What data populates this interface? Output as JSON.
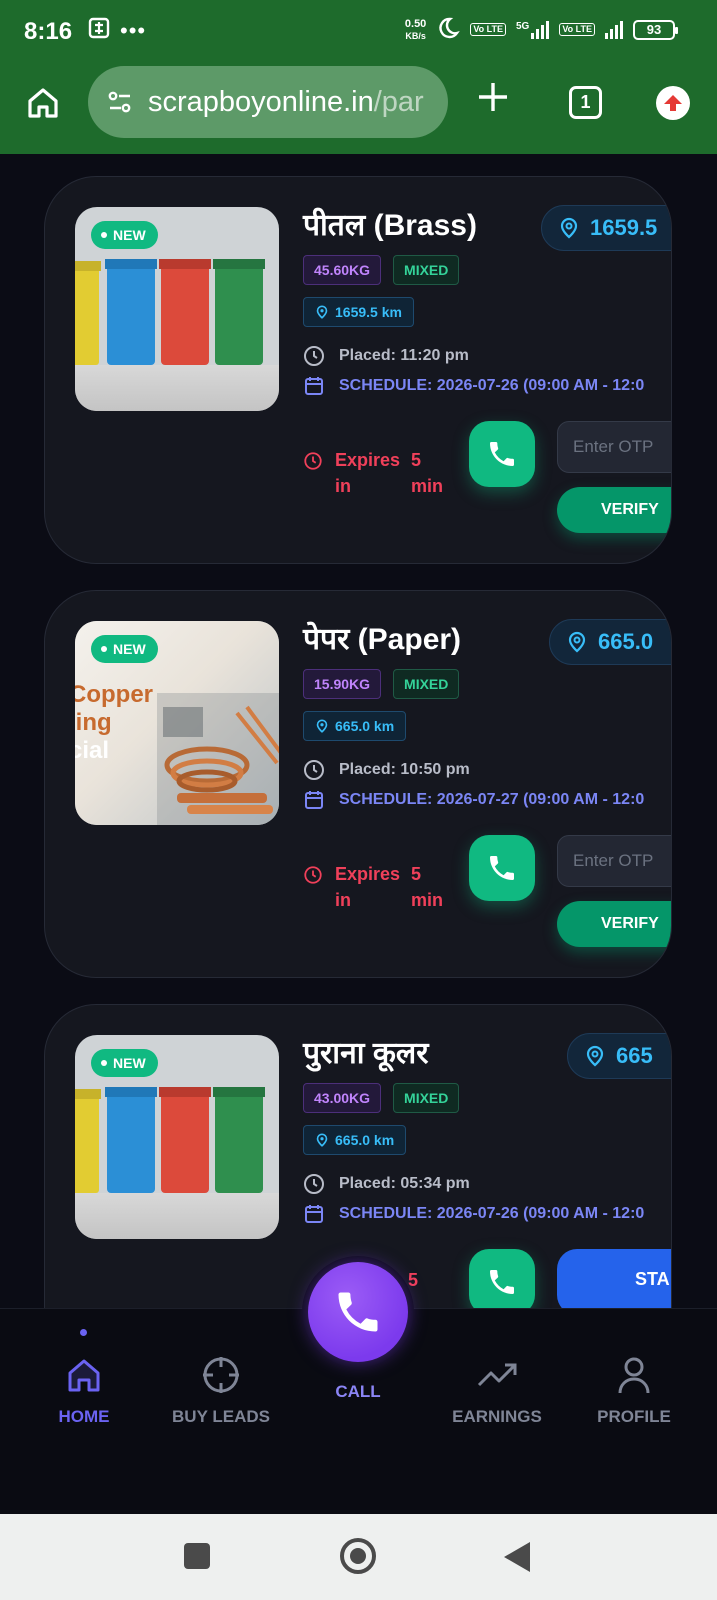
{
  "status_bar": {
    "time": "8:16",
    "net_speed_value": "0.50",
    "net_speed_unit": "KB/s",
    "volte1": "Vo LTE",
    "network": "5G",
    "volte2": "Vo LTE",
    "battery": "93"
  },
  "browser": {
    "url_main": "scrapboyonline.in",
    "url_rest": "/par",
    "tab_count": "1"
  },
  "leads": [
    {
      "badge": "NEW",
      "title": "पीतल (Brass)",
      "distance_pill": "1659.5",
      "weight": "45.60KG",
      "category": "MIXED",
      "distance_km": "1659.5 km",
      "placed": "Placed: 11:20 pm",
      "schedule": "SCHEDULE: 2026-07-26 (09:00 AM - 12:0",
      "expires_label": "Expires in",
      "expires_value": "5 min",
      "otp_placeholder": "Enter OTP",
      "verify_label": "VERIFY"
    },
    {
      "badge": "NEW",
      "title": "पेपर (Paper)",
      "distance_pill": "665.0",
      "weight": "15.90KG",
      "category": "MIXED",
      "distance_km": "665.0 km",
      "placed": "Placed: 10:50 pm",
      "schedule": "SCHEDULE: 2026-07-27 (09:00 AM - 12:0",
      "expires_label": "Expires in",
      "expires_value": "5 min",
      "otp_placeholder": "Enter OTP",
      "verify_label": "VERIFY",
      "image_text": [
        "Copper",
        "ling",
        "cial"
      ]
    },
    {
      "badge": "NEW",
      "title": "पुराना कूलर",
      "distance_pill": "665",
      "weight": "43.00KG",
      "category": "MIXED",
      "distance_km": "665.0 km",
      "placed": "Placed: 05:34 pm",
      "schedule": "SCHEDULE: 2026-07-26 (09:00 AM - 12:0",
      "expires_value": "5",
      "start_label": "STA"
    }
  ],
  "bottom_nav": {
    "home": "HOME",
    "buy_leads": "BUY LEADS",
    "call": "CALL",
    "earnings": "EARNINGS",
    "profile": "PROFILE"
  },
  "colors": {
    "browser_green": "#1e6b2c",
    "card_bg": "#15171f",
    "accent_green": "#10b981",
    "accent_purple": "#7c3aed",
    "accent_blue": "#38bdf8",
    "nav_active": "#6b63f2",
    "expires_red": "#f0405a"
  }
}
